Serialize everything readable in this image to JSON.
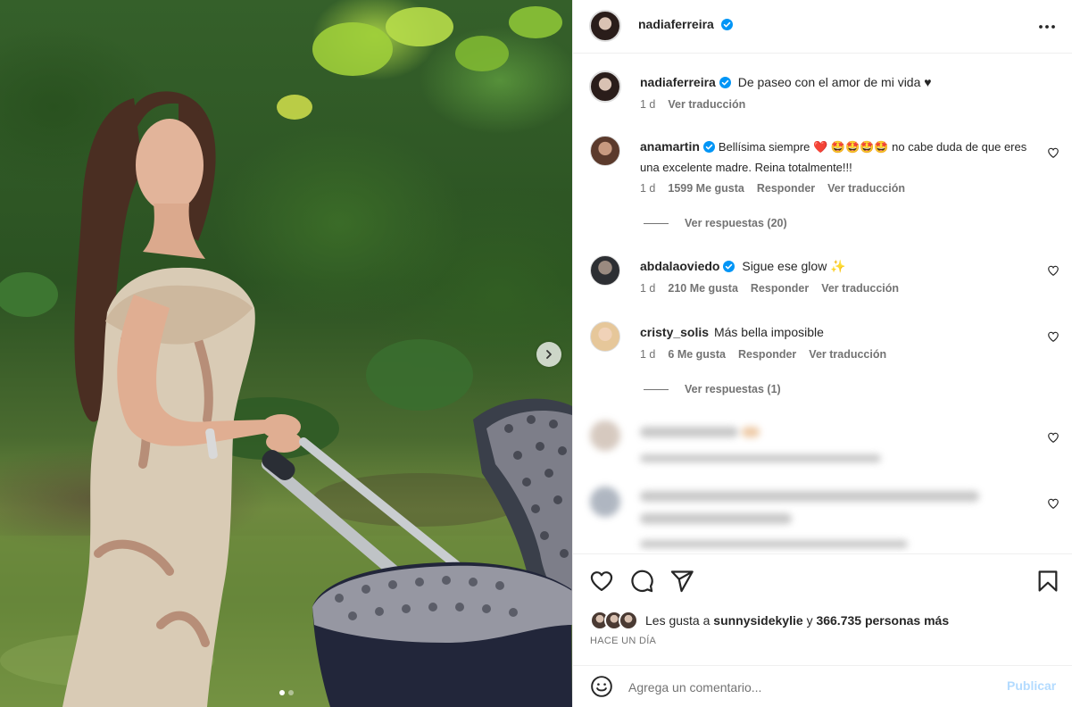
{
  "post": {
    "author": "nadiaferreira",
    "caption": "De paseo con el amor de mi vida ♥",
    "caption_time": "1 d",
    "see_translation": "Ver traducción"
  },
  "comments": [
    {
      "user": "anamartin",
      "verified": true,
      "text": "Bellísima siempre ❤️ 🤩🤩🤩🤩 no cabe duda de que eres una excelente madre. Reina totalmente!!!",
      "time": "1 d",
      "likes": "1599 Me gusta",
      "reply": "Responder",
      "translate": "Ver traducción",
      "replies": "Ver respuestas (20)"
    },
    {
      "user": "abdalaoviedo",
      "verified": true,
      "text": "Sigue ese glow ✨",
      "time": "1 d",
      "likes": "210 Me gusta",
      "reply": "Responder",
      "translate": "Ver traducción"
    },
    {
      "user": "cristy_solis",
      "verified": false,
      "text": "Más bella imposible",
      "time": "1 d",
      "likes": "6 Me gusta",
      "reply": "Responder",
      "translate": "Ver traducción",
      "replies": "Ver respuestas (1)"
    }
  ],
  "likes": {
    "prefix": "Les gusta a",
    "user": "sunnysidekylie",
    "connector": "y",
    "others": "366.735 personas más"
  },
  "timestamp": "HACE UN DÍA",
  "composer": {
    "placeholder": "Agrega un comentario...",
    "publish": "Publicar"
  },
  "colors": {
    "verified": "#0095f6",
    "publish_disabled": "#b3dbff",
    "secondary_text": "#737373"
  },
  "carousel": {
    "current": 1,
    "total": 2
  }
}
